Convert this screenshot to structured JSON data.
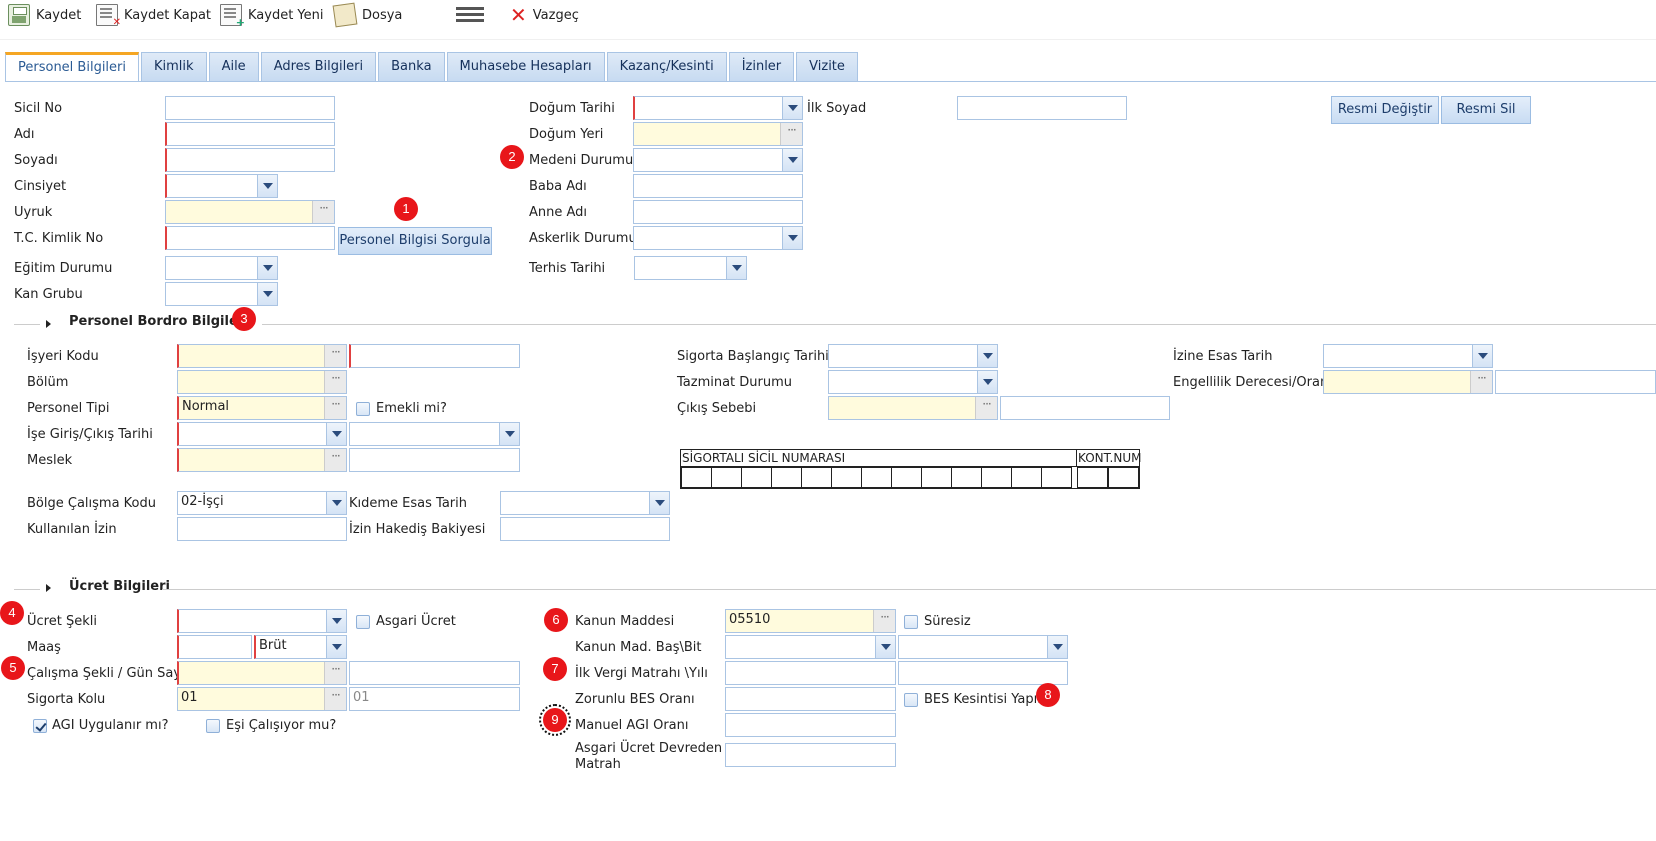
{
  "toolbar": {
    "save": "Kaydet",
    "save_close": "Kaydet Kapat",
    "save_new": "Kaydet Yeni",
    "file": "Dosya",
    "cancel": "Vazgeç"
  },
  "tabs": [
    "Personel Bilgileri",
    "Kimlik",
    "Aile",
    "Adres Bilgileri",
    "Banka",
    "Muhasebe Hesapları",
    "Kazanç/Kesinti",
    "İzinler",
    "Vizite"
  ],
  "personal": {
    "sicil_no": "Sicil No",
    "adi": "Adı",
    "soyadi": "Soyadı",
    "cinsiyet": "Cinsiyet",
    "uyruk": "Uyruk",
    "tc_kimlik": "T.C. Kimlik No",
    "egitim": "Eğitim Durumu",
    "kan_grubu": "Kan Grubu",
    "sorgula_button": "Personel Bilgisi Sorgula",
    "dogum_tarihi": "Doğum Tarihi",
    "dogum_yeri": "Doğum Yeri",
    "medeni_durumu": "Medeni Durumu",
    "baba_adi": "Baba Adı",
    "anne_adi": "Anne Adı",
    "askerlik": "Askerlik Durumu",
    "terhis": "Terhis Tarihi",
    "ilk_soyad": "İlk Soyad",
    "resmi_degistir": "Resmi Değiştir",
    "resmi_sil": "Resmi Sil"
  },
  "bordro": {
    "title": "Personel Bordro Bilgileri",
    "isyeri_kodu": "İşyeri Kodu",
    "bolum": "Bölüm",
    "personel_tipi": "Personel Tipi",
    "personel_tipi_value": "Normal",
    "emekli": "Emekli mi?",
    "ise_giris": "İşe Giriş/Çıkış Tarihi",
    "meslek": "Meslek",
    "bolge_calisma": "Bölge Çalışma Kodu",
    "bolge_calisma_value": "02-İşçi",
    "kideme_esas": "Kıdeme Esas Tarih",
    "kullanilan_izin": "Kullanılan İzin",
    "izin_hakedis": "İzin Hakediş Bakiyesi",
    "sigorta_baslangic": "Sigorta Başlangıç Tarihi",
    "tazminat": "Tazminat Durumu",
    "cikis_sebebi": "Çıkış Sebebi",
    "izine_esas": "İzine Esas Tarih",
    "engellilik": "Engellilik Derecesi/Oranı",
    "sgk_header": "SİGORTALI SİCİL NUMARASI",
    "kont_header": "KONT.NUM"
  },
  "ucret": {
    "title": "Ücret Bilgileri",
    "ucret_sekli": "Ücret Şekli",
    "asgari_ucret": "Asgari Ücret",
    "maas": "Maaş",
    "brut_value": "Brüt",
    "calisma_sekli": "Çalışma Şekli / Gün Sayısı",
    "sigorta_kolu": "Sigorta Kolu",
    "sigorta_kolu_value": "01",
    "sigorta_kolu_value2": "01",
    "agi_uygulanir": "AGI Uygulanır mı?",
    "esi_calisiyor": "Eşi Çalışıyor mu?",
    "kanun_maddesi": "Kanun Maddesi",
    "kanun_maddesi_value": "05510",
    "suresiz": "Süresiz",
    "kanun_bas_bit": "Kanun Mad. Baş\\Bit",
    "ilk_vergi": "İlk Vergi Matrahı \\Yılı",
    "zorunlu_bes": "Zorunlu BES Oranı",
    "bes_kesintisi": "BES Kesintisi Yapılır",
    "manuel_agi": "Manuel AGI Oranı",
    "asgari_devreden_1": "Asgari Ücret Devreden",
    "asgari_devreden_2": "Matrah"
  },
  "markers": [
    "1",
    "2",
    "3",
    "4",
    "5",
    "6",
    "7",
    "8",
    "9"
  ],
  "colors": {
    "accent_tab": "#f5a623",
    "marker": "#e8161a",
    "required": "#e04040",
    "lookup_bg": "#fffbdd"
  }
}
